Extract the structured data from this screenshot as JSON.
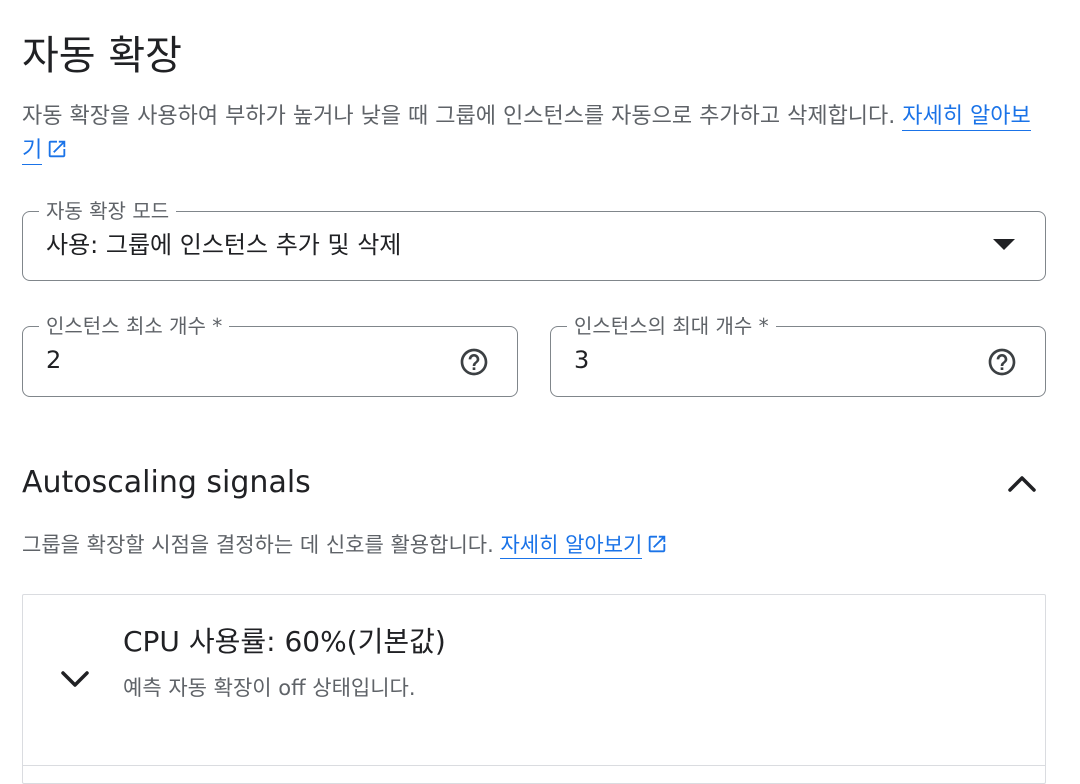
{
  "page": {
    "title": "자동 확장",
    "description_text": "자동 확장을 사용하여 부하가 높거나 낮을 때 그룹에 인스턴스를 자동으로 추가하고 삭제합니다. ",
    "description_link": "자세히 알아보기"
  },
  "mode_field": {
    "label": "자동 확장 모드",
    "value": "사용: 그룹에 인스턴스 추가 및 삭제",
    "icon": "dropdown-arrow"
  },
  "min_field": {
    "label": "인스턴스 최소 개수 *",
    "value": "2",
    "icon": "help-circle"
  },
  "max_field": {
    "label": "인스턴스의 최대 개수 *",
    "value": "3",
    "icon": "help-circle"
  },
  "signals": {
    "title": "Autoscaling signals",
    "description_text": "그룹을 확장할 시점을 결정하는 데 신호를 활용합니다. ",
    "description_link": "자세히 알아보기",
    "collapse_icon": "chevron-up",
    "items": [
      {
        "title": "CPU 사용률: 60%(기본값)",
        "subtitle": "예측 자동 확장이 off 상태입니다.",
        "expand_icon": "chevron-down"
      }
    ]
  },
  "colors": {
    "text": "#202124",
    "secondary": "#5f6368",
    "link": "#1a73e8",
    "border": "#80868b",
    "panel_border": "#dadce0"
  }
}
